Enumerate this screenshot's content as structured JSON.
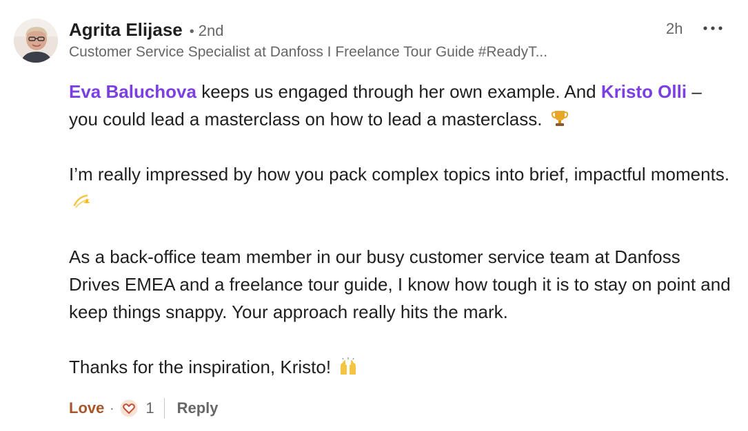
{
  "comment": {
    "author": {
      "name": "Agrita Elijase",
      "degree": "2nd",
      "degree_separator": "•",
      "headline": "Customer Service Specialist at Danfoss I Freelance Tour Guide #ReadyT..."
    },
    "timestamp": "2h",
    "more_icon": "ellipsis-icon",
    "paragraphs": {
      "p1": {
        "mention1": "Eva Baluchova",
        "text1": " keeps us engaged through her own example. And ",
        "mention2": "Kristo Olli",
        "text2": " – you could lead a masterclass on how to lead a masterclass.",
        "emoji": "trophy-emoji"
      },
      "p2": {
        "text": "I’m really impressed by how you pack complex topics into brief, impactful moments.",
        "emoji": "dizzy-emoji"
      },
      "p3": {
        "text": "As a back-office team member in our busy customer service team at Danfoss Drives EMEA and a freelance tour guide, I know how tough it is to stay on point and keep things snappy. Your approach really hits the mark."
      },
      "p4": {
        "text": "Thanks for the inspiration, Kristo!",
        "emoji": "raising-hands-emoji"
      }
    },
    "actions": {
      "reaction_label": "Love",
      "separator": "·",
      "reaction_icon": "love-reaction-icon",
      "reaction_count": "1",
      "reply_label": "Reply"
    },
    "colors": {
      "mention": "#7b3fe4",
      "love": "#a8552a",
      "secondary_text": "#666666"
    }
  }
}
